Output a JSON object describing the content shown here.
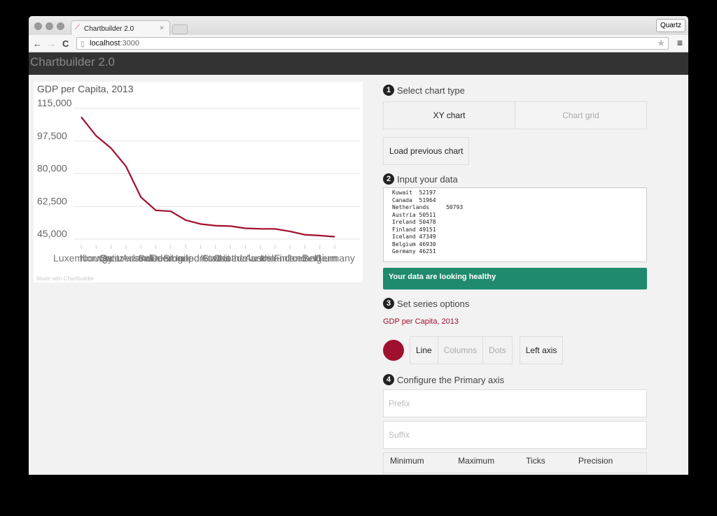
{
  "browser": {
    "tab_title": "Chartbuilder 2.0",
    "url_host": "localhost",
    "url_port": ":3000",
    "profile_button": "Quartz"
  },
  "app": {
    "title": "Chartbuilder 2.0"
  },
  "chart": {
    "watermark": "Made with Chartbuilder"
  },
  "chart_data": {
    "type": "line",
    "title": "GDP per Capita, 2013",
    "categories": [
      "Luxembourg",
      "Norway",
      "Qatar",
      "Switzerland",
      "Australia",
      "Sweden",
      "Denmark",
      "Singapore",
      "United States",
      "Kuwait",
      "Canada",
      "Netherlands",
      "Austria",
      "Ireland",
      "Finland",
      "Iceland",
      "Belgium",
      "Germany"
    ],
    "series": [
      {
        "name": "GDP per Capita, 2013",
        "values": [
          110400,
          100300,
          93700,
          84000,
          67500,
          60400,
          59900,
          55200,
          53100,
          52197,
          51964,
          50793,
          50511,
          50478,
          49151,
          47349,
          46930,
          46251
        ]
      }
    ],
    "ylim": [
      45000,
      115000
    ],
    "yticks": [
      "115,000",
      "97,500",
      "80,000",
      "62,500",
      "45,000"
    ],
    "grid": true,
    "color": "#a0102e"
  },
  "panel": {
    "step1": {
      "num": "1",
      "label": "Select chart type",
      "xy": "XY chart",
      "grid": "Chart grid",
      "load": "Load previous chart"
    },
    "step2": {
      "num": "2",
      "label": "Input your data",
      "text": "Kuwait  52197\nCanada  51964\nNetherlands     50793\nAustria 50511\nIreland 50478\nFinland 49151\nIceland 47349\nBelgium 46930\nGermany 46251",
      "status": "Your data are looking healthy",
      "status_color": "#1f8a6d"
    },
    "step3": {
      "num": "3",
      "label": "Set series options",
      "series_name": "GDP per Capita, 2013",
      "types": [
        "Line",
        "Columns",
        "Dots"
      ],
      "axis": "Left axis",
      "color": "#a0102e"
    },
    "step4": {
      "num": "4",
      "label": "Configure the Primary axis",
      "prefix_placeholder": "Prefix",
      "suffix_placeholder": "Suffix",
      "columns": [
        "Minimum",
        "Maximum",
        "Ticks",
        "Precision"
      ]
    }
  }
}
